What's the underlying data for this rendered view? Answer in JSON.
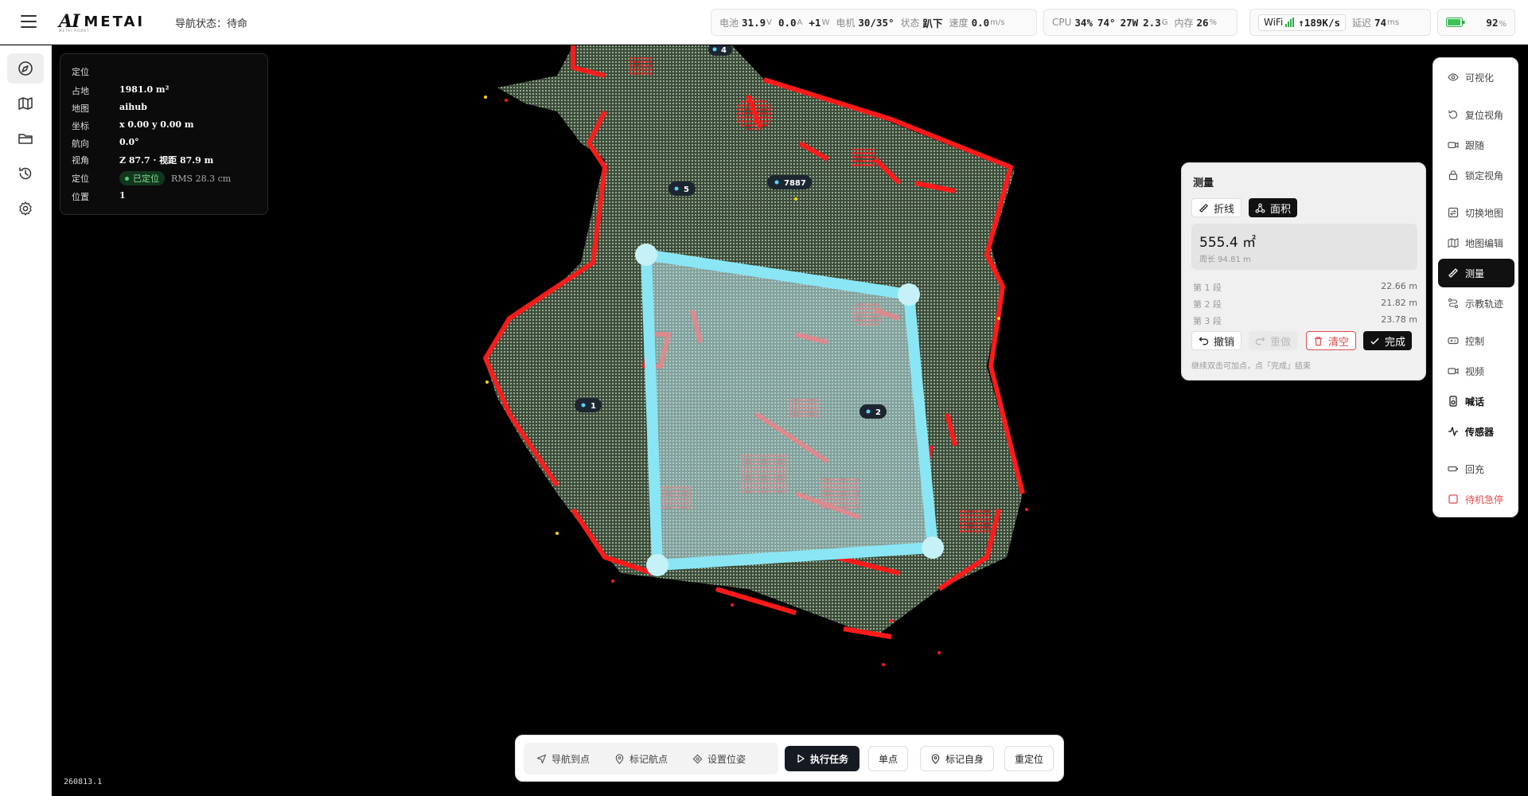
{
  "header": {
    "logo_mark": "AI",
    "logo_name": "METAI",
    "logo_sub": "METAI ROBOT",
    "nav_state": "导航状态：待命"
  },
  "status": {
    "battery_label": "电池",
    "battery_voltage": "31.9",
    "battery_voltage_unit": "V",
    "battery_current": "0.0",
    "battery_current_unit": "A",
    "battery_power": "+1",
    "battery_power_unit": "W",
    "motor_label": "电机",
    "motor_value": "30/35°",
    "state_label": "状态",
    "state_value": "趴下",
    "speed_label": "速度",
    "speed_value": "0.0",
    "speed_unit": "m/s",
    "cpu_label": "CPU",
    "cpu_usage": "34%",
    "cpu_temp": "74°",
    "cpu_power": "27W",
    "cpu_freq": "2.3",
    "cpu_freq_unit": "G",
    "mem_label": "内存",
    "mem_usage": "26",
    "mem_unit": "%",
    "wifi_label": "WiFi",
    "wifi_rate": "↑189K/s",
    "latency_label": "延迟",
    "latency_value": "74",
    "latency_unit": "ms",
    "battery_percent": "92",
    "battery_percent_unit": "%"
  },
  "sidebar": {
    "items": [
      {
        "name": "compass-icon",
        "active": true
      },
      {
        "name": "map-icon",
        "active": false
      },
      {
        "name": "folder-icon",
        "active": false
      },
      {
        "name": "history-icon",
        "active": false
      },
      {
        "name": "gear-icon",
        "active": false
      }
    ]
  },
  "info": {
    "title": "定位",
    "rows": [
      {
        "k": "占地",
        "v": "1981.0 m²"
      },
      {
        "k": "地图",
        "v": "aihub"
      },
      {
        "k": "坐标",
        "v": "x 0.00  y 0.00 m"
      },
      {
        "k": "航向",
        "v": "0.0°"
      },
      {
        "k": "视角",
        "v": "Z 87.7 · 视距 87.9 m"
      }
    ],
    "loc_key": "定位",
    "loc_badge": "已定位",
    "loc_rms": "RMS 28.3 cm",
    "pos_key": "位置",
    "pos_value": "1"
  },
  "map_labels": {
    "wp4": "4",
    "wp5": "5",
    "wp7887": "7887",
    "wp1": "1",
    "wp2": "2"
  },
  "measure": {
    "title": "测量",
    "tab_polyline": "折线",
    "tab_area": "面积",
    "area_value": "555.4 ㎡",
    "perimeter": "周长 94.81 m",
    "segments": [
      {
        "label": "第 1 段",
        "value": "22.66 m"
      },
      {
        "label": "第 2 段",
        "value": "21.82 m"
      },
      {
        "label": "第 3 段",
        "value": "23.78 m"
      }
    ],
    "btn_undo": "撤销",
    "btn_redo": "重做",
    "btn_clear": "清空",
    "btn_done": "完成",
    "hint": "继续双击可加点，点「完成」结束"
  },
  "right_panel": {
    "items": [
      {
        "label": "可视化",
        "icon": "eye-icon"
      },
      {
        "label": "复位视角",
        "icon": "reset-icon"
      },
      {
        "label": "跟随",
        "icon": "camera-icon"
      },
      {
        "label": "锁定视角",
        "icon": "lock-icon"
      },
      {
        "label": "切换地图",
        "icon": "switch-map-icon"
      },
      {
        "label": "地图编辑",
        "icon": "map-edit-icon"
      },
      {
        "label": "测量",
        "icon": "ruler-icon"
      },
      {
        "label": "示教轨迹",
        "icon": "route-icon"
      },
      {
        "label": "控制",
        "icon": "gamepad-icon"
      },
      {
        "label": "视频",
        "icon": "video-icon"
      },
      {
        "label": "喊话",
        "icon": "speaker-icon"
      },
      {
        "label": "传感器",
        "icon": "pulse-icon"
      },
      {
        "label": "回充",
        "icon": "charge-icon"
      },
      {
        "label": "待机急停",
        "icon": "stop-icon"
      }
    ]
  },
  "bottom": {
    "nav_to_point": "导航到点",
    "mark_waypoint": "标记航点",
    "set_pose": "设置位姿",
    "execute_task": "执行任务",
    "single_point": "单点",
    "mark_self": "标记自身",
    "relocate": "重定位"
  },
  "build": "260813.1",
  "colors": {
    "accent": "#111111",
    "danger": "#e24a4a",
    "measure_fill": "#7de3ee",
    "obstacle": "#ff1a1a",
    "floor": "#8fa38c"
  }
}
